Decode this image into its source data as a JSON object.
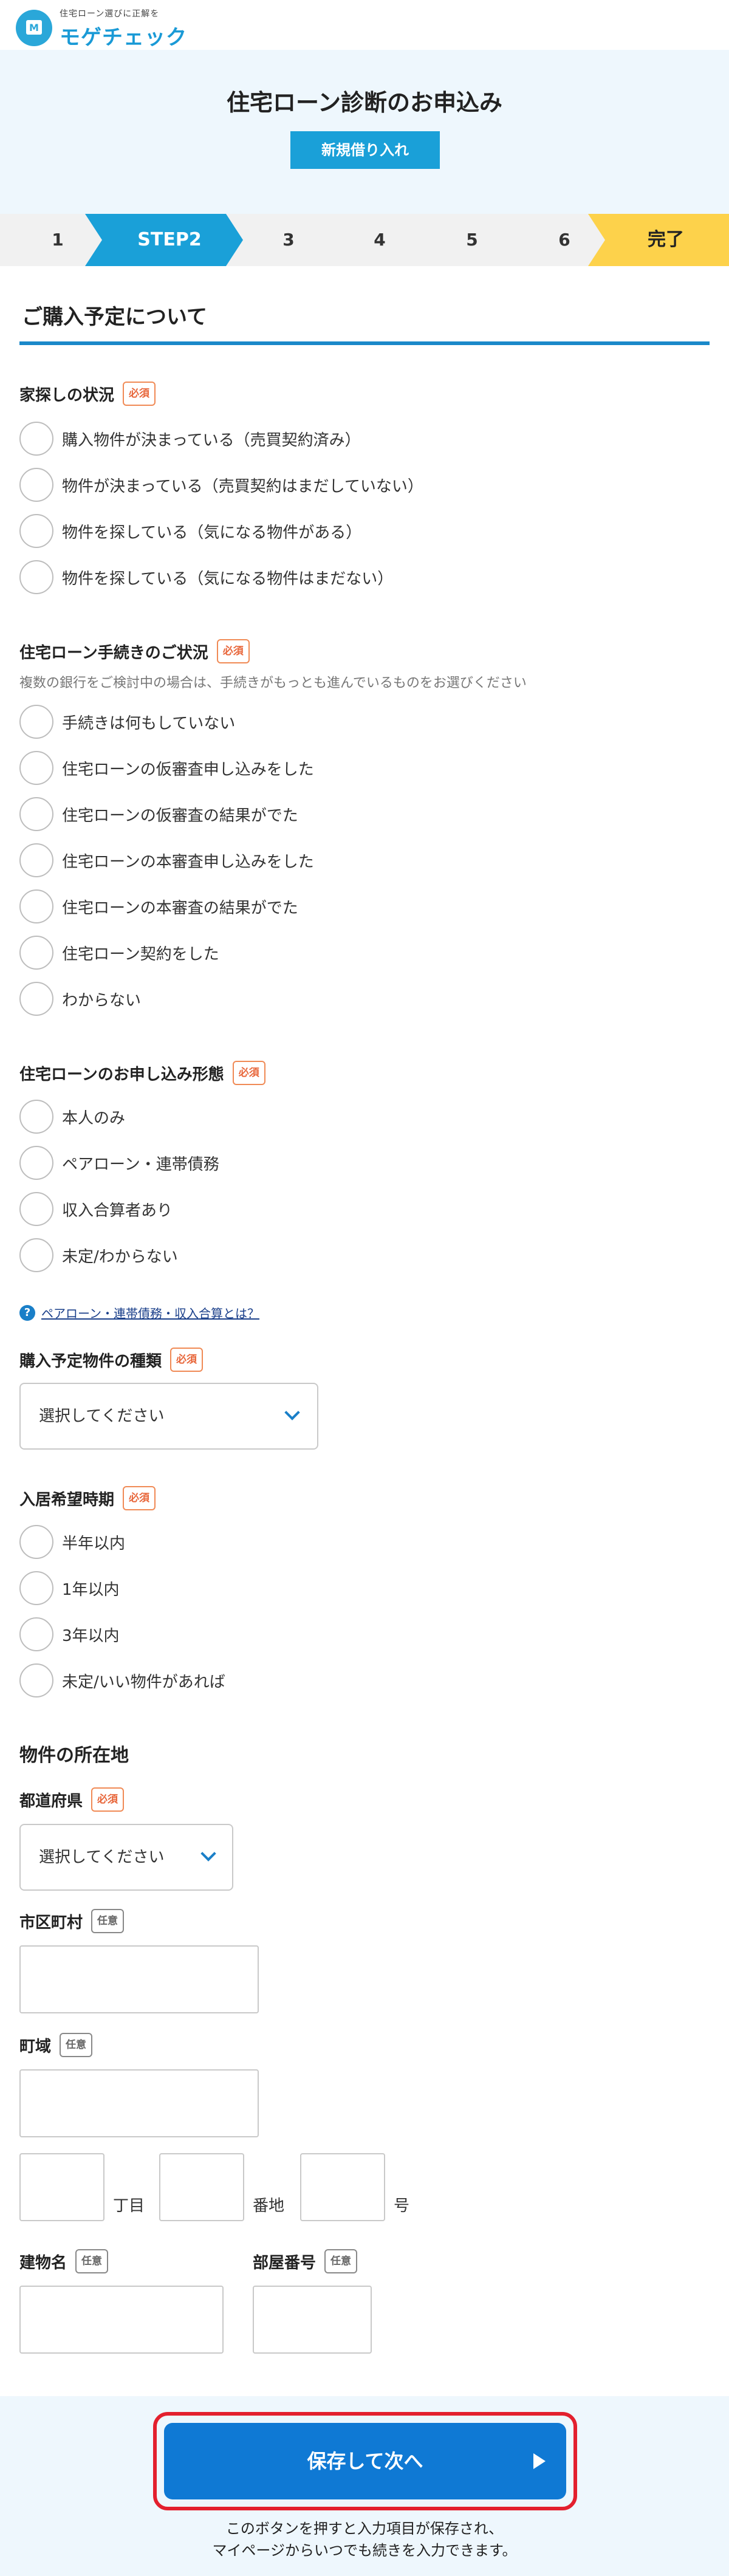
{
  "header": {
    "tagline": "住宅ローン選びに正解を",
    "brand": "モゲチェック",
    "logo_letter": "M"
  },
  "title": {
    "text": "住宅ローン診断のお申込み",
    "badge": "新規借り入れ"
  },
  "steps": {
    "s1": "1",
    "active": "STEP2",
    "s3": "3",
    "s4": "4",
    "s5": "5",
    "s6": "6",
    "done": "完了"
  },
  "section": {
    "title": "ご購入予定について"
  },
  "badges": {
    "required": "必須",
    "optional": "任意"
  },
  "house_hunting": {
    "label": "家探しの状況",
    "options": [
      "購入物件が決まっている（売買契約済み）",
      "物件が決まっている（売買契約はまだしていない）",
      "物件を探している（気になる物件がある）",
      "物件を探している（気になる物件はまだない）"
    ]
  },
  "loan_procedure": {
    "label": "住宅ローン手続きのご状況",
    "note": "複数の銀行をご検討中の場合は、手続きがもっとも進んでいるものをお選びください",
    "options": [
      "手続きは何もしていない",
      "住宅ローンの仮審査申し込みをした",
      "住宅ローンの仮審査の結果がでた",
      "住宅ローンの本審査申し込みをした",
      "住宅ローンの本審査の結果がでた",
      "住宅ローン契約をした",
      "わからない"
    ]
  },
  "application_type": {
    "label": "住宅ローンのお申し込み形態",
    "options": [
      "本人のみ",
      "ペアローン・連帯債務",
      "収入合算者あり",
      "未定/わからない"
    ],
    "help": "ペアローン・連帯債務・収入合算とは？",
    "help_icon": "?"
  },
  "property_type": {
    "label": "購入予定物件の種類",
    "placeholder": "選択してください"
  },
  "move_in": {
    "label": "入居希望時期",
    "options": [
      "半年以内",
      "1年以内",
      "3年以内",
      "未定/いい物件があれば"
    ]
  },
  "location": {
    "heading": "物件の所在地",
    "prefecture_label": "都道府県",
    "prefecture_placeholder": "選択してください",
    "city_label": "市区町村",
    "town_label": "町域",
    "chome": "丁目",
    "banchi": "番地",
    "go": "号",
    "building_label": "建物名",
    "room_label": "部屋番号"
  },
  "footer": {
    "save": "保存して次へ",
    "note_line1": "このボタンを押すと入力項目が保存され、",
    "note_line2": "マイページからいつでも続きを入力できます。"
  }
}
